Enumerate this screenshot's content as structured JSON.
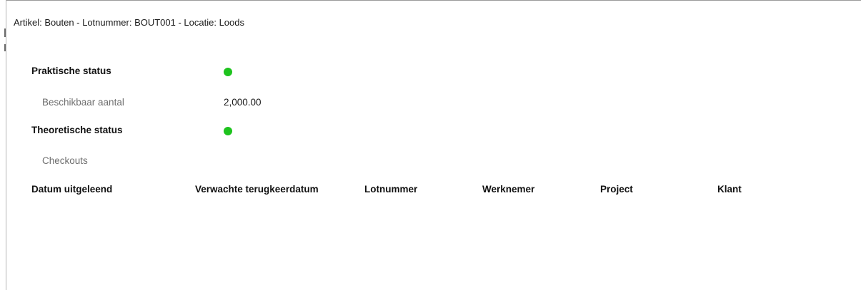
{
  "header": {
    "title": "Artikel: Bouten - Lotnummer: BOUT001 - Locatie: Loods"
  },
  "practical_status": {
    "label": "Praktische status",
    "status_color": "#1ec31e",
    "available_label": "Beschikbaar aantal",
    "available_value": "2,000.00"
  },
  "theoretical_status": {
    "label": "Theoretische status",
    "status_color": "#1ec31e"
  },
  "checkouts": {
    "label": "Checkouts",
    "columns": [
      "Datum uitgeleend",
      "Verwachte terugkeerdatum",
      "Lotnummer",
      "Werknemer",
      "Project",
      "Klant"
    ],
    "rows": []
  }
}
